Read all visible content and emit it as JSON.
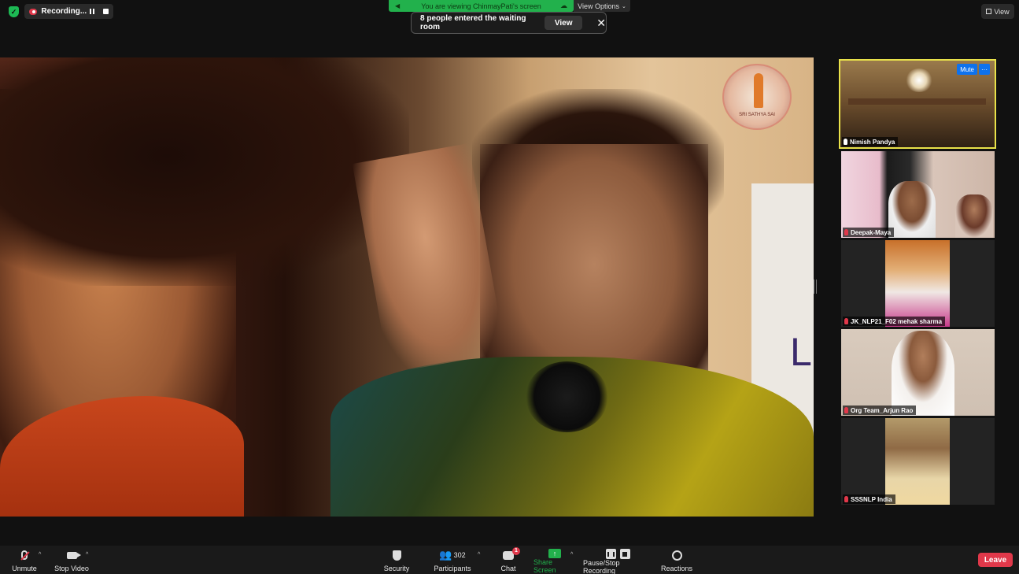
{
  "top": {
    "recording_label": "Recording...",
    "viewing_banner": "You are viewing ChinmayPati's screen",
    "view_options": "View Options",
    "waiting_room_msg": "8 people entered the waiting room",
    "waiting_view_btn": "View",
    "waiting_close": "✕",
    "view_btn": "View"
  },
  "share": {
    "board_letter": "L",
    "logo_text": "SRI SATHYA SAI"
  },
  "gallery": [
    {
      "name": "Nimish Pandya",
      "mic": "on",
      "active": true,
      "mute_btn": "Mute",
      "more_btn": "···"
    },
    {
      "name": "Deepak-Maya",
      "mic": "off"
    },
    {
      "name": "JK_NLP21_F02 mehak sharma",
      "mic": "off"
    },
    {
      "name": "Org Team_Arjun Rao",
      "mic": "off"
    },
    {
      "name": "SSSNLP India",
      "mic": "off"
    }
  ],
  "toolbar": {
    "unmute": "Unmute",
    "stop_video": "Stop Video",
    "security": "Security",
    "participants": "Participants",
    "participants_count": "302",
    "chat": "Chat",
    "chat_badge": "1",
    "share_screen": "Share Screen",
    "pause_stop": "Pause/Stop Recording",
    "reactions": "Reactions",
    "leave": "Leave"
  },
  "colors": {
    "accent_green": "#22b14c",
    "leave_red": "#e0384a",
    "active_speaker": "#e9e24a",
    "button_blue": "#0e72ed"
  }
}
